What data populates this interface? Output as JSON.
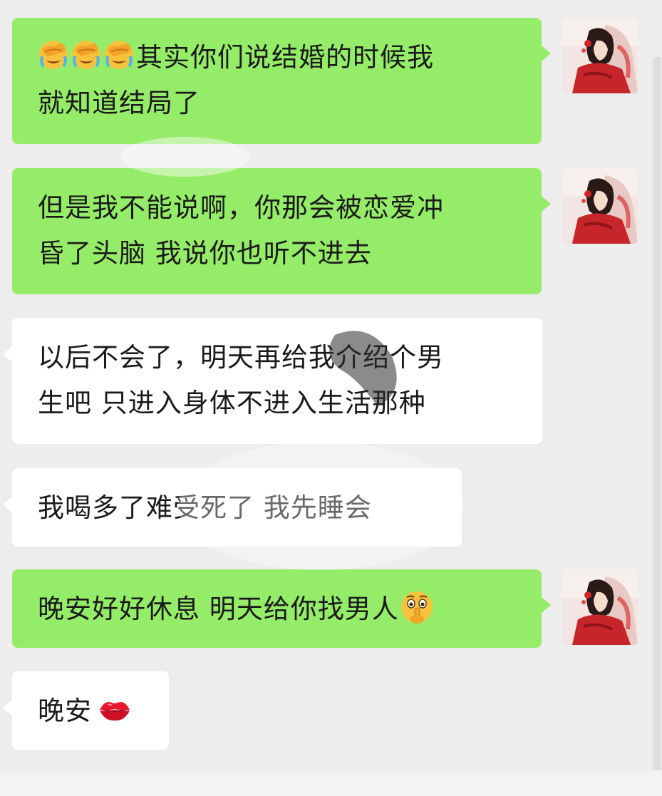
{
  "messages": [
    {
      "sender": "self",
      "emojis": [
        "face-palm-crying-emoji",
        "face-palm-crying-emoji",
        "face-palm-crying-emoji"
      ],
      "line1": "其实你们说结婚的时候我",
      "line2": "就知道结局了"
    },
    {
      "sender": "self",
      "line1": "但是我不能说啊，你那会被恋爱冲",
      "line2": "昏了头脑 我说你也听不进去"
    },
    {
      "sender": "other",
      "line1": "以后不会了，明天再给我介绍个男",
      "line2": "生吧 只进入身体不进入生活那种"
    },
    {
      "sender": "other",
      "line1": "我喝多了难受死了 我先睡会"
    },
    {
      "sender": "self",
      "line1": "晚安好好休息  明天给你找男人",
      "trailing_emoji": "shushing-face-emoji"
    },
    {
      "sender": "other",
      "line1": "晚安",
      "trailing_emoji": "kiss-lips-emoji"
    }
  ],
  "colors": {
    "background": "#ededed",
    "sent_bubble": "#95ec69",
    "received_bubble": "#ffffff",
    "text": "#1a1a1a"
  }
}
